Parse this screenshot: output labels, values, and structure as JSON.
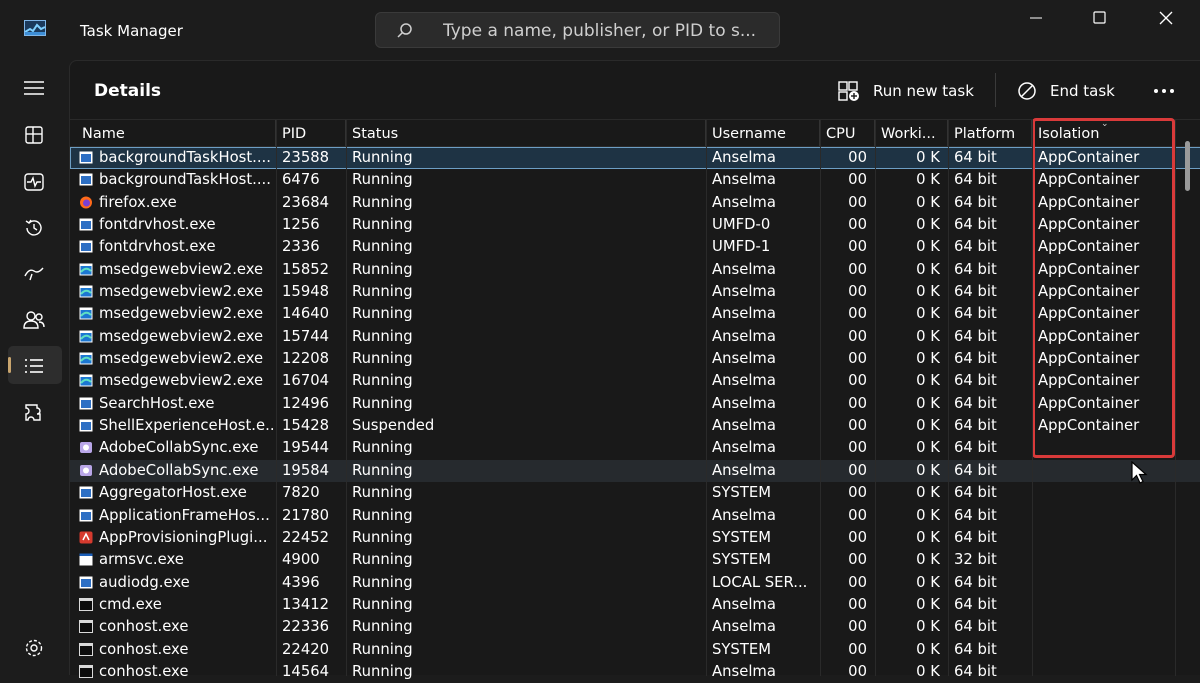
{
  "app": {
    "title": "Task Manager"
  },
  "search": {
    "placeholder": "Type a name, publisher, or PID to s..."
  },
  "nav": {
    "selected": "details"
  },
  "page": {
    "title": "Details"
  },
  "toolbar": {
    "run_new_task": "Run new task",
    "end_task": "End task"
  },
  "columns": [
    "Name",
    "PID",
    "Status",
    "Username",
    "CPU",
    "Worki...",
    "Platform",
    "Isolation"
  ],
  "rows": [
    {
      "name": "backgroundTaskHost....",
      "pid": "23588",
      "status": "Running",
      "user": "Anselma",
      "cpu": "00",
      "mem": "0 K",
      "platform": "64 bit",
      "isolation": "AppContainer",
      "icon": "window"
    },
    {
      "name": "backgroundTaskHost....",
      "pid": "6476",
      "status": "Running",
      "user": "Anselma",
      "cpu": "00",
      "mem": "0 K",
      "platform": "64 bit",
      "isolation": "AppContainer",
      "icon": "window"
    },
    {
      "name": "firefox.exe",
      "pid": "23684",
      "status": "Running",
      "user": "Anselma",
      "cpu": "00",
      "mem": "0 K",
      "platform": "64 bit",
      "isolation": "AppContainer",
      "icon": "firefox"
    },
    {
      "name": "fontdrvhost.exe",
      "pid": "1256",
      "status": "Running",
      "user": "UMFD-0",
      "cpu": "00",
      "mem": "0 K",
      "platform": "64 bit",
      "isolation": "AppContainer",
      "icon": "window"
    },
    {
      "name": "fontdrvhost.exe",
      "pid": "2336",
      "status": "Running",
      "user": "UMFD-1",
      "cpu": "00",
      "mem": "0 K",
      "platform": "64 bit",
      "isolation": "AppContainer",
      "icon": "window"
    },
    {
      "name": "msedgewebview2.exe",
      "pid": "15852",
      "status": "Running",
      "user": "Anselma",
      "cpu": "00",
      "mem": "0 K",
      "platform": "64 bit",
      "isolation": "AppContainer",
      "icon": "edge"
    },
    {
      "name": "msedgewebview2.exe",
      "pid": "15948",
      "status": "Running",
      "user": "Anselma",
      "cpu": "00",
      "mem": "0 K",
      "platform": "64 bit",
      "isolation": "AppContainer",
      "icon": "edge"
    },
    {
      "name": "msedgewebview2.exe",
      "pid": "14640",
      "status": "Running",
      "user": "Anselma",
      "cpu": "00",
      "mem": "0 K",
      "platform": "64 bit",
      "isolation": "AppContainer",
      "icon": "edge"
    },
    {
      "name": "msedgewebview2.exe",
      "pid": "15744",
      "status": "Running",
      "user": "Anselma",
      "cpu": "00",
      "mem": "0 K",
      "platform": "64 bit",
      "isolation": "AppContainer",
      "icon": "edge"
    },
    {
      "name": "msedgewebview2.exe",
      "pid": "12208",
      "status": "Running",
      "user": "Anselma",
      "cpu": "00",
      "mem": "0 K",
      "platform": "64 bit",
      "isolation": "AppContainer",
      "icon": "edge"
    },
    {
      "name": "msedgewebview2.exe",
      "pid": "16704",
      "status": "Running",
      "user": "Anselma",
      "cpu": "00",
      "mem": "0 K",
      "platform": "64 bit",
      "isolation": "AppContainer",
      "icon": "edge"
    },
    {
      "name": "SearchHost.exe",
      "pid": "12496",
      "status": "Running",
      "user": "Anselma",
      "cpu": "00",
      "mem": "0 K",
      "platform": "64 bit",
      "isolation": "AppContainer",
      "icon": "window"
    },
    {
      "name": "ShellExperienceHost.e...",
      "pid": "15428",
      "status": "Suspended",
      "user": "Anselma",
      "cpu": "00",
      "mem": "0 K",
      "platform": "64 bit",
      "isolation": "AppContainer",
      "icon": "window"
    },
    {
      "name": "AdobeCollabSync.exe",
      "pid": "19544",
      "status": "Running",
      "user": "Anselma",
      "cpu": "00",
      "mem": "0 K",
      "platform": "64 bit",
      "isolation": "",
      "icon": "adobe"
    },
    {
      "name": "AdobeCollabSync.exe",
      "pid": "19584",
      "status": "Running",
      "user": "Anselma",
      "cpu": "00",
      "mem": "0 K",
      "platform": "64 bit",
      "isolation": "",
      "icon": "adobe"
    },
    {
      "name": "AggregatorHost.exe",
      "pid": "7820",
      "status": "Running",
      "user": "SYSTEM",
      "cpu": "00",
      "mem": "0 K",
      "platform": "64 bit",
      "isolation": "",
      "icon": "window"
    },
    {
      "name": "ApplicationFrameHos...",
      "pid": "21780",
      "status": "Running",
      "user": "Anselma",
      "cpu": "00",
      "mem": "0 K",
      "platform": "64 bit",
      "isolation": "",
      "icon": "window"
    },
    {
      "name": "AppProvisioningPlugi...",
      "pid": "22452",
      "status": "Running",
      "user": "SYSTEM",
      "cpu": "00",
      "mem": "0 K",
      "platform": "64 bit",
      "isolation": "",
      "icon": "red"
    },
    {
      "name": "armsvc.exe",
      "pid": "4900",
      "status": "Running",
      "user": "SYSTEM",
      "cpu": "00",
      "mem": "0 K",
      "platform": "32 bit",
      "isolation": "",
      "icon": "white"
    },
    {
      "name": "audiodg.exe",
      "pid": "4396",
      "status": "Running",
      "user": "LOCAL SER...",
      "cpu": "00",
      "mem": "0 K",
      "platform": "64 bit",
      "isolation": "",
      "icon": "window"
    },
    {
      "name": "cmd.exe",
      "pid": "13412",
      "status": "Running",
      "user": "Anselma",
      "cpu": "00",
      "mem": "0 K",
      "platform": "64 bit",
      "isolation": "",
      "icon": "console"
    },
    {
      "name": "conhost.exe",
      "pid": "22336",
      "status": "Running",
      "user": "Anselma",
      "cpu": "00",
      "mem": "0 K",
      "platform": "64 bit",
      "isolation": "",
      "icon": "console"
    },
    {
      "name": "conhost.exe",
      "pid": "22420",
      "status": "Running",
      "user": "SYSTEM",
      "cpu": "00",
      "mem": "0 K",
      "platform": "64 bit",
      "isolation": "",
      "icon": "console"
    },
    {
      "name": "conhost.exe",
      "pid": "14564",
      "status": "Running",
      "user": "Anselma",
      "cpu": "00",
      "mem": "0 K",
      "platform": "64 bit",
      "isolation": "",
      "icon": "console"
    }
  ]
}
